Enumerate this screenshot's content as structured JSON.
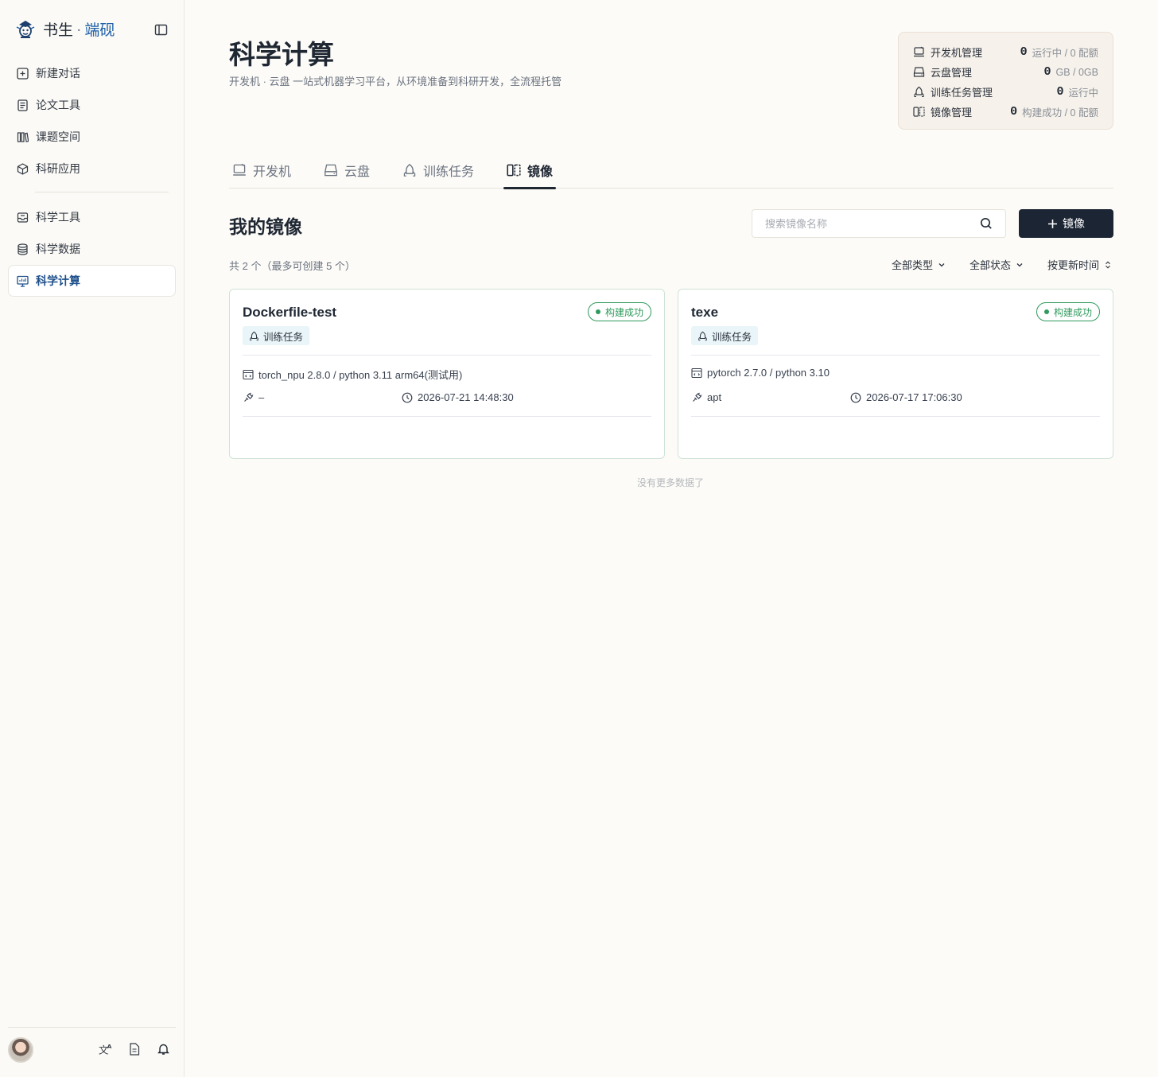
{
  "brand": {
    "name": "书生",
    "separator": "·",
    "accent": "端砚"
  },
  "sidebar": {
    "items": [
      {
        "label": "新建对话",
        "icon": "new-chat-icon"
      },
      {
        "label": "论文工具",
        "icon": "document-icon"
      },
      {
        "label": "课题空间",
        "icon": "books-icon"
      },
      {
        "label": "科研应用",
        "icon": "cube-icon"
      },
      {
        "label": "科学工具",
        "icon": "toolbox-icon"
      },
      {
        "label": "科学数据",
        "icon": "database-icon"
      },
      {
        "label": "科学计算",
        "icon": "monitor-icon",
        "active": true
      }
    ]
  },
  "header": {
    "title": "科学计算",
    "subtitle": "开发机 · 云盘 一站式机器学习平台，从环境准备到科研开发，全流程托管"
  },
  "stats": [
    {
      "label": "开发机管理",
      "value": "0",
      "unit": "运行中 / 0 配额",
      "icon": "devmachine-icon"
    },
    {
      "label": "云盘管理",
      "value": "0",
      "unit": "GB / 0GB",
      "icon": "disk-icon"
    },
    {
      "label": "训练任务管理",
      "value": "0",
      "unit": "运行中",
      "icon": "training-icon"
    },
    {
      "label": "镜像管理",
      "value": "0",
      "unit": "构建成功 / 0 配额",
      "icon": "image-icon"
    }
  ],
  "tabs": [
    {
      "label": "开发机",
      "icon": "devmachine-icon"
    },
    {
      "label": "云盘",
      "icon": "disk-icon"
    },
    {
      "label": "训练任务",
      "icon": "training-icon"
    },
    {
      "label": "镜像",
      "icon": "image-icon",
      "active": true
    }
  ],
  "section": {
    "title": "我的镜像",
    "search_placeholder": "搜索镜像名称",
    "new_button": "镜像",
    "count_text": "共 2 个（最多可创建 5 个）",
    "filters": [
      "全部类型",
      "全部状态",
      "按更新时间"
    ]
  },
  "cards": [
    {
      "name": "Dockerfile-test",
      "status": "构建成功",
      "tag": "训练任务",
      "env": "torch_npu 2.8.0 / python 3.11 arm64(测试用)",
      "source": "–",
      "time": "2026-07-21 14:48:30"
    },
    {
      "name": "texe",
      "status": "构建成功",
      "tag": "训练任务",
      "env": "pytorch 2.7.0 / python 3.10",
      "source": "apt",
      "time": "2026-07-17 17:06:30"
    }
  ],
  "footer_text": "没有更多数据了",
  "colors": {
    "accent": "#1d5fa8",
    "success": "#2f9a5c",
    "primary_button": "#1c2533",
    "background": "#fcfbf7"
  }
}
